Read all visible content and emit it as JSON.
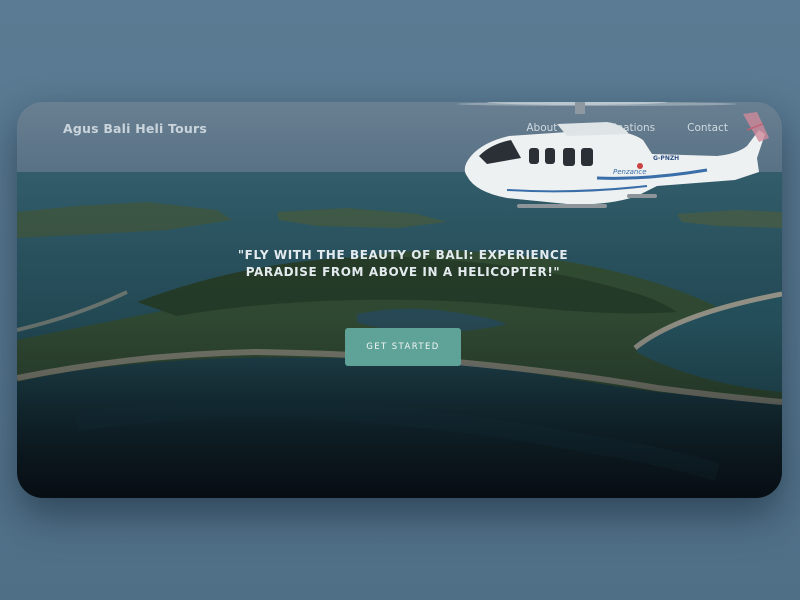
{
  "site": {
    "brand": "Agus Bali Heli Tours"
  },
  "nav": {
    "items": [
      "About",
      "Destinations",
      "Contact"
    ]
  },
  "hero": {
    "headline": "\"FLY WITH THE BEAUTY OF BALI: EXPERIENCE PARADISE FROM ABOVE IN A HELICOPTER!\"",
    "cta_label": "GET STARTED",
    "aircraft_registration": "G-PNZH",
    "aircraft_livery": "Penzance"
  },
  "colors": {
    "page_background": "#587a92",
    "cta_background": "#5fa398",
    "text_light": "#e4ebef"
  }
}
